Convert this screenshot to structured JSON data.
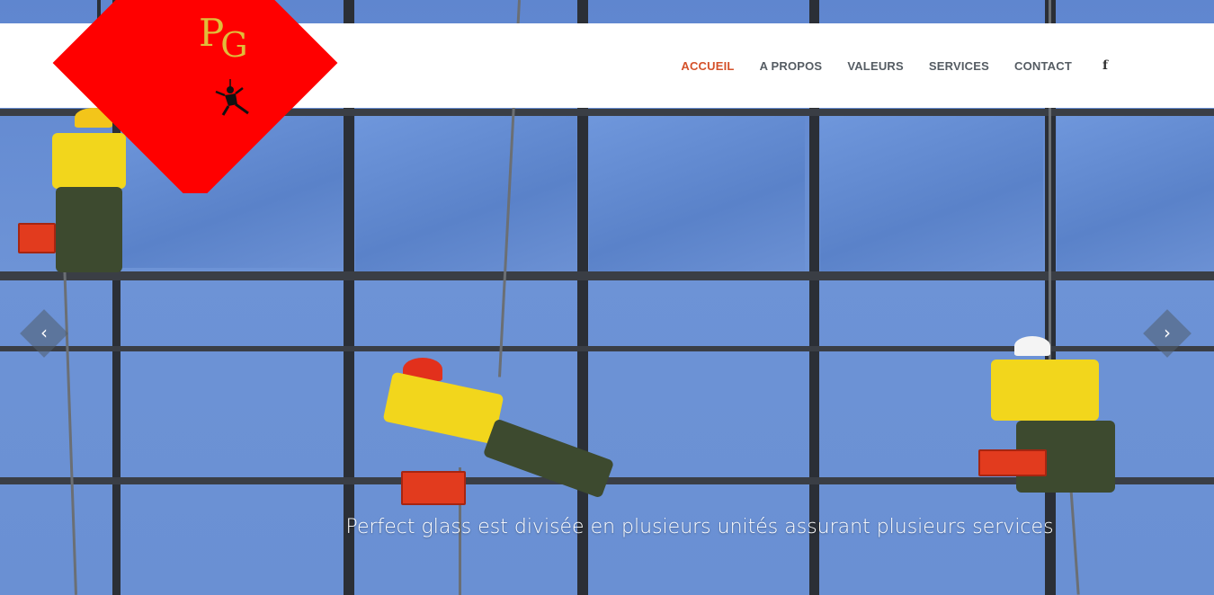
{
  "header": {
    "logo": {
      "letters": "PG",
      "colors": {
        "diamond": "#ff0000",
        "letters": "#e0bd3a"
      },
      "icon": "rope-climber-icon"
    },
    "nav": {
      "items": [
        {
          "label": "ACCUEIL",
          "active": true
        },
        {
          "label": "A PROPOS",
          "active": false
        },
        {
          "label": "VALEURS",
          "active": false
        },
        {
          "label": "SERVICES",
          "active": false
        },
        {
          "label": "CONTACT",
          "active": false
        }
      ],
      "social": {
        "label": "f",
        "icon": "facebook-icon"
      },
      "colors": {
        "active": "#d4512a",
        "default": "#555c63"
      }
    }
  },
  "slider": {
    "image": "window-cleaners-on-glass-facade",
    "caption": "Perfect glass est divisée en plusieurs unités assurant plusieurs services",
    "prev": {
      "label": "‹",
      "icon": "chevron-left-icon"
    },
    "next": {
      "label": "›",
      "icon": "chevron-right-icon"
    }
  }
}
